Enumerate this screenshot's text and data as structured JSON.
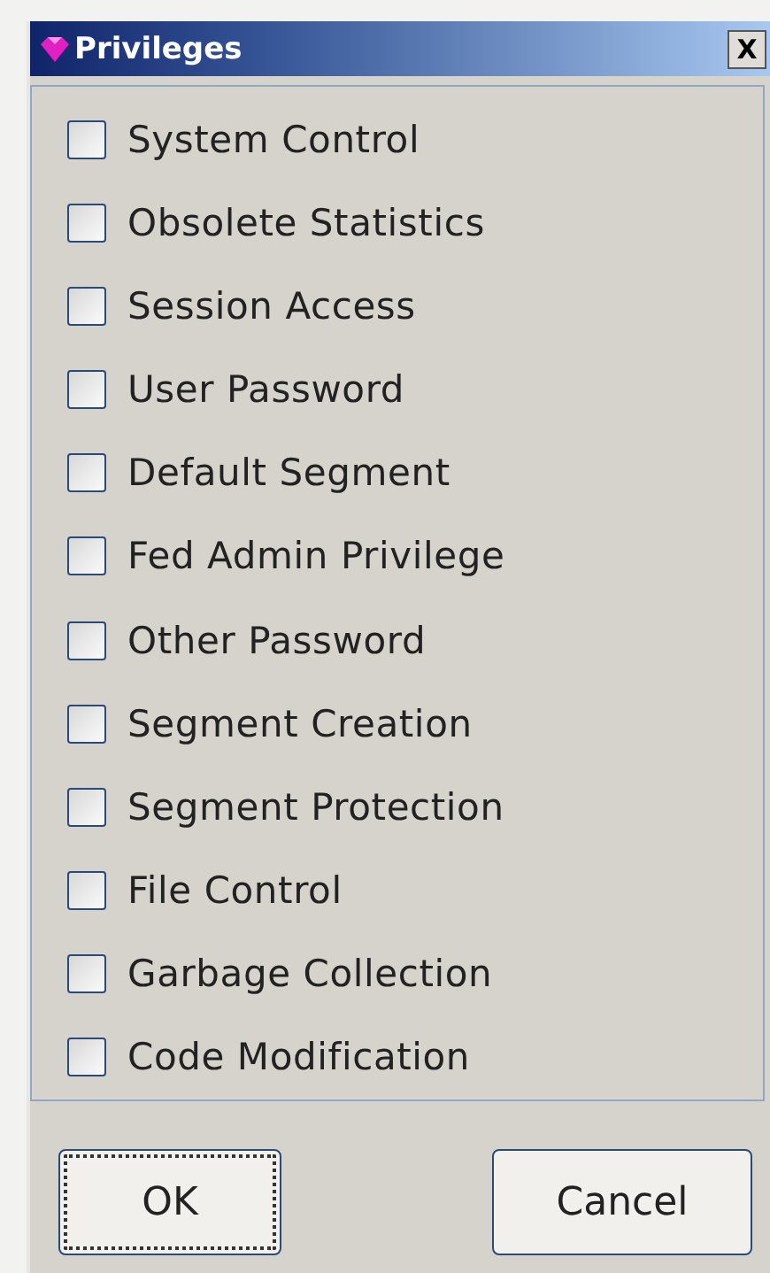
{
  "window": {
    "title": "Privileges",
    "close": "X"
  },
  "privileges": [
    {
      "label": "System Control",
      "checked": false
    },
    {
      "label": "Obsolete Statistics",
      "checked": false
    },
    {
      "label": "Session Access",
      "checked": false
    },
    {
      "label": "User Password",
      "checked": false
    },
    {
      "label": "Default Segment",
      "checked": false
    },
    {
      "label": "Fed Admin Privilege",
      "checked": false
    },
    {
      "label": "Other Password",
      "checked": false
    },
    {
      "label": "Segment Creation",
      "checked": false
    },
    {
      "label": "Segment Protection",
      "checked": false
    },
    {
      "label": "File Control",
      "checked": false
    },
    {
      "label": "Garbage Collection",
      "checked": false
    },
    {
      "label": "Code Modification",
      "checked": false
    }
  ],
  "buttons": [
    {
      "label": "OK",
      "focused": true
    },
    {
      "label": "Cancel",
      "focused": false
    }
  ]
}
